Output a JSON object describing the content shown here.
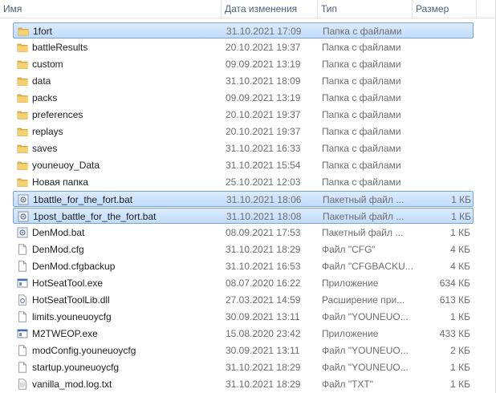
{
  "columns": {
    "name": "Имя",
    "date": "Дата изменения",
    "type": "Тип",
    "size": "Размер"
  },
  "files": [
    {
      "name": "1fort",
      "date": "31.10.2021 17:09",
      "type": "Папка с файлами",
      "size": "",
      "icon": "folder-icon",
      "selected": true
    },
    {
      "name": "battleResults",
      "date": "20.10.2021 19:37",
      "type": "Папка с файлами",
      "size": "",
      "icon": "folder-icon",
      "selected": false
    },
    {
      "name": "custom",
      "date": "09.09.2021 13:19",
      "type": "Папка с файлами",
      "size": "",
      "icon": "folder-icon",
      "selected": false
    },
    {
      "name": "data",
      "date": "31.10.2021 18:09",
      "type": "Папка с файлами",
      "size": "",
      "icon": "folder-icon",
      "selected": false
    },
    {
      "name": "packs",
      "date": "09.09.2021 13:19",
      "type": "Папка с файлами",
      "size": "",
      "icon": "folder-icon",
      "selected": false
    },
    {
      "name": "preferences",
      "date": "20.10.2021 19:37",
      "type": "Папка с файлами",
      "size": "",
      "icon": "folder-icon",
      "selected": false
    },
    {
      "name": "replays",
      "date": "20.10.2021 19:37",
      "type": "Папка с файлами",
      "size": "",
      "icon": "folder-icon",
      "selected": false
    },
    {
      "name": "saves",
      "date": "31.10.2021 16:33",
      "type": "Папка с файлами",
      "size": "",
      "icon": "folder-icon",
      "selected": false
    },
    {
      "name": "youneuoy_Data",
      "date": "31.10.2021 15:54",
      "type": "Папка с файлами",
      "size": "",
      "icon": "folder-icon",
      "selected": false
    },
    {
      "name": "Новая папка",
      "date": "25.10.2021 12:03",
      "type": "Папка с файлами",
      "size": "",
      "icon": "folder-icon",
      "selected": false
    },
    {
      "name": "1battle_for_the_fort.bat",
      "date": "31.10.2021 18:06",
      "type": "Пакетный файл ...",
      "size": "1 КБ",
      "icon": "batch-file-icon",
      "selected": true
    },
    {
      "name": "1post_battle_for_the_fort.bat",
      "date": "31.10.2021 18:08",
      "type": "Пакетный файл ...",
      "size": "1 КБ",
      "icon": "batch-file-icon",
      "selected": true
    },
    {
      "name": "DenMod.bat",
      "date": "08.09.2021 17:53",
      "type": "Пакетный файл ...",
      "size": "1 КБ",
      "icon": "batch-file-icon",
      "selected": false
    },
    {
      "name": "DenMod.cfg",
      "date": "31.10.2021 18:29",
      "type": "Файл \"CFG\"",
      "size": "4 КБ",
      "icon": "file-icon",
      "selected": false
    },
    {
      "name": "DenMod.cfgbackup",
      "date": "31.10.2021 16:53",
      "type": "Файл \"CFGBACKU...",
      "size": "4 КБ",
      "icon": "file-icon",
      "selected": false
    },
    {
      "name": "HotSeatTool.exe",
      "date": "08.07.2020 16:22",
      "type": "Приложение",
      "size": "634 КБ",
      "icon": "application-icon",
      "selected": false
    },
    {
      "name": "HotSeatToolLib.dll",
      "date": "27.03.2021 14:59",
      "type": "Расширение при...",
      "size": "613 КБ",
      "icon": "dll-icon",
      "selected": false
    },
    {
      "name": "limits.youneuoycfg",
      "date": "30.09.2021 13:11",
      "type": "Файл \"YOUNEUO...",
      "size": "1 КБ",
      "icon": "file-icon",
      "selected": false
    },
    {
      "name": "M2TWEOP.exe",
      "date": "15.08.2020 23:42",
      "type": "Приложение",
      "size": "433 КБ",
      "icon": "application-icon",
      "selected": false
    },
    {
      "name": "modConfig.youneuoycfg",
      "date": "30.09.2021 13:11",
      "type": "Файл \"YOUNEUO...",
      "size": "2 КБ",
      "icon": "file-icon",
      "selected": false
    },
    {
      "name": "startup.youneuoycfg",
      "date": "31.10.2021 18:29",
      "type": "Файл \"YOUNEUO...",
      "size": "1 КБ",
      "icon": "file-icon",
      "selected": false
    },
    {
      "name": "vanilla_mod.log.txt",
      "date": "31.10.2021 18:29",
      "type": "Файл \"TXT\"",
      "size": "1 КБ",
      "icon": "text-file-icon",
      "selected": false
    }
  ]
}
